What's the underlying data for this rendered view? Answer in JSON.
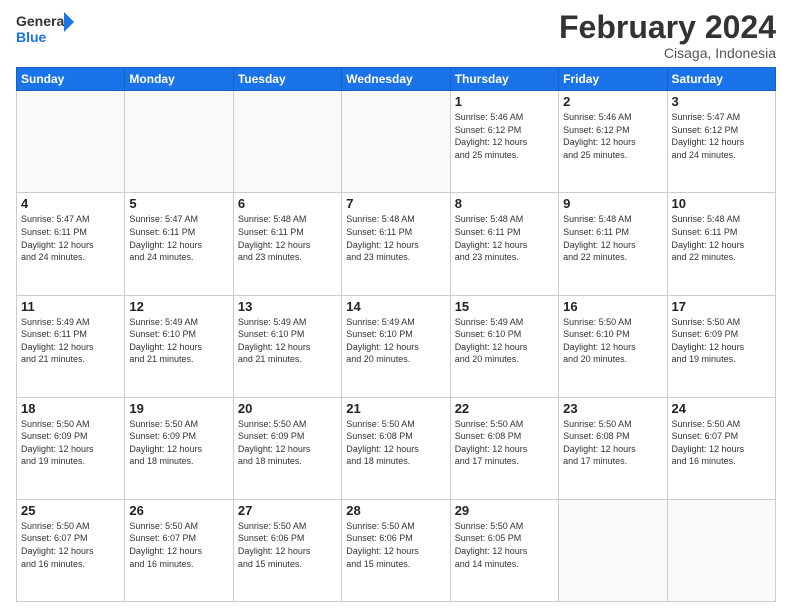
{
  "header": {
    "logo_text_general": "General",
    "logo_text_blue": "Blue",
    "main_title": "February 2024",
    "subtitle": "Cisaga, Indonesia"
  },
  "calendar": {
    "days_of_week": [
      "Sunday",
      "Monday",
      "Tuesday",
      "Wednesday",
      "Thursday",
      "Friday",
      "Saturday"
    ],
    "weeks": [
      [
        {
          "day": "",
          "info": ""
        },
        {
          "day": "",
          "info": ""
        },
        {
          "day": "",
          "info": ""
        },
        {
          "day": "",
          "info": ""
        },
        {
          "day": "1",
          "info": "Sunrise: 5:46 AM\nSunset: 6:12 PM\nDaylight: 12 hours\nand 25 minutes."
        },
        {
          "day": "2",
          "info": "Sunrise: 5:46 AM\nSunset: 6:12 PM\nDaylight: 12 hours\nand 25 minutes."
        },
        {
          "day": "3",
          "info": "Sunrise: 5:47 AM\nSunset: 6:12 PM\nDaylight: 12 hours\nand 24 minutes."
        }
      ],
      [
        {
          "day": "4",
          "info": "Sunrise: 5:47 AM\nSunset: 6:11 PM\nDaylight: 12 hours\nand 24 minutes."
        },
        {
          "day": "5",
          "info": "Sunrise: 5:47 AM\nSunset: 6:11 PM\nDaylight: 12 hours\nand 24 minutes."
        },
        {
          "day": "6",
          "info": "Sunrise: 5:48 AM\nSunset: 6:11 PM\nDaylight: 12 hours\nand 23 minutes."
        },
        {
          "day": "7",
          "info": "Sunrise: 5:48 AM\nSunset: 6:11 PM\nDaylight: 12 hours\nand 23 minutes."
        },
        {
          "day": "8",
          "info": "Sunrise: 5:48 AM\nSunset: 6:11 PM\nDaylight: 12 hours\nand 23 minutes."
        },
        {
          "day": "9",
          "info": "Sunrise: 5:48 AM\nSunset: 6:11 PM\nDaylight: 12 hours\nand 22 minutes."
        },
        {
          "day": "10",
          "info": "Sunrise: 5:48 AM\nSunset: 6:11 PM\nDaylight: 12 hours\nand 22 minutes."
        }
      ],
      [
        {
          "day": "11",
          "info": "Sunrise: 5:49 AM\nSunset: 6:11 PM\nDaylight: 12 hours\nand 21 minutes."
        },
        {
          "day": "12",
          "info": "Sunrise: 5:49 AM\nSunset: 6:10 PM\nDaylight: 12 hours\nand 21 minutes."
        },
        {
          "day": "13",
          "info": "Sunrise: 5:49 AM\nSunset: 6:10 PM\nDaylight: 12 hours\nand 21 minutes."
        },
        {
          "day": "14",
          "info": "Sunrise: 5:49 AM\nSunset: 6:10 PM\nDaylight: 12 hours\nand 20 minutes."
        },
        {
          "day": "15",
          "info": "Sunrise: 5:49 AM\nSunset: 6:10 PM\nDaylight: 12 hours\nand 20 minutes."
        },
        {
          "day": "16",
          "info": "Sunrise: 5:50 AM\nSunset: 6:10 PM\nDaylight: 12 hours\nand 20 minutes."
        },
        {
          "day": "17",
          "info": "Sunrise: 5:50 AM\nSunset: 6:09 PM\nDaylight: 12 hours\nand 19 minutes."
        }
      ],
      [
        {
          "day": "18",
          "info": "Sunrise: 5:50 AM\nSunset: 6:09 PM\nDaylight: 12 hours\nand 19 minutes."
        },
        {
          "day": "19",
          "info": "Sunrise: 5:50 AM\nSunset: 6:09 PM\nDaylight: 12 hours\nand 18 minutes."
        },
        {
          "day": "20",
          "info": "Sunrise: 5:50 AM\nSunset: 6:09 PM\nDaylight: 12 hours\nand 18 minutes."
        },
        {
          "day": "21",
          "info": "Sunrise: 5:50 AM\nSunset: 6:08 PM\nDaylight: 12 hours\nand 18 minutes."
        },
        {
          "day": "22",
          "info": "Sunrise: 5:50 AM\nSunset: 6:08 PM\nDaylight: 12 hours\nand 17 minutes."
        },
        {
          "day": "23",
          "info": "Sunrise: 5:50 AM\nSunset: 6:08 PM\nDaylight: 12 hours\nand 17 minutes."
        },
        {
          "day": "24",
          "info": "Sunrise: 5:50 AM\nSunset: 6:07 PM\nDaylight: 12 hours\nand 16 minutes."
        }
      ],
      [
        {
          "day": "25",
          "info": "Sunrise: 5:50 AM\nSunset: 6:07 PM\nDaylight: 12 hours\nand 16 minutes."
        },
        {
          "day": "26",
          "info": "Sunrise: 5:50 AM\nSunset: 6:07 PM\nDaylight: 12 hours\nand 16 minutes."
        },
        {
          "day": "27",
          "info": "Sunrise: 5:50 AM\nSunset: 6:06 PM\nDaylight: 12 hours\nand 15 minutes."
        },
        {
          "day": "28",
          "info": "Sunrise: 5:50 AM\nSunset: 6:06 PM\nDaylight: 12 hours\nand 15 minutes."
        },
        {
          "day": "29",
          "info": "Sunrise: 5:50 AM\nSunset: 6:05 PM\nDaylight: 12 hours\nand 14 minutes."
        },
        {
          "day": "",
          "info": ""
        },
        {
          "day": "",
          "info": ""
        }
      ]
    ]
  }
}
